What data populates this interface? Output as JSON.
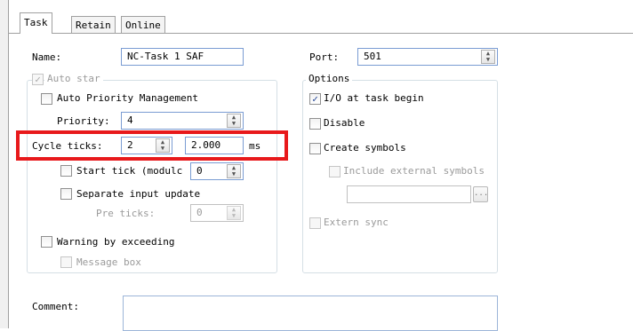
{
  "tabs": [
    {
      "label": "Task",
      "active": true
    },
    {
      "label": "Retain",
      "active": false
    },
    {
      "label": "Online",
      "active": false
    }
  ],
  "name": {
    "label": "Name:",
    "value": "NC-Task 1 SAF"
  },
  "port": {
    "label": "Port:",
    "value": "501"
  },
  "auto_start": {
    "label": "Auto star",
    "checked": true,
    "enabled": false
  },
  "auto_priority": {
    "label": "Auto Priority Management",
    "checked": false
  },
  "priority": {
    "label": "Priority:",
    "value": "4"
  },
  "cycle_ticks": {
    "label": "Cycle ticks:",
    "value": "2",
    "time_value": "2.000",
    "unit": "ms"
  },
  "start_tick": {
    "label": "Start tick (modulc",
    "value": "0",
    "checked": false
  },
  "separate_input": {
    "label": "Separate input update",
    "checked": false
  },
  "pre_ticks": {
    "label": "Pre ticks:",
    "value": "0"
  },
  "warning_exceeding": {
    "label": "Warning by exceeding",
    "checked": false
  },
  "message_box": {
    "label": "Message box",
    "checked": false,
    "enabled": false
  },
  "options": {
    "title": "Options",
    "io_at_task_begin": {
      "label": "I/O at task begin",
      "checked": true
    },
    "disable": {
      "label": "Disable",
      "checked": false
    },
    "create_symbols": {
      "label": "Create symbols",
      "checked": false
    },
    "include_external": {
      "label": "Include external symbols",
      "checked": false,
      "enabled": false
    },
    "symbols_path": {
      "value": ""
    },
    "browse_button_label": "...",
    "extern_sync": {
      "label": "Extern sync",
      "checked": false,
      "enabled": false
    }
  },
  "comment": {
    "label": "Comment:",
    "value": ""
  },
  "highlight_color": "#e8191b",
  "check_glyph": "✓"
}
